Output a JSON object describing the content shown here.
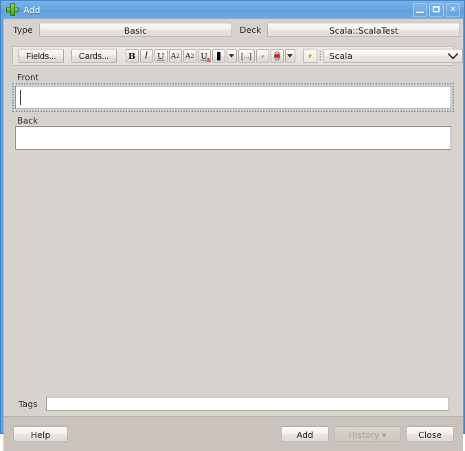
{
  "window": {
    "title": "Add",
    "icon": "green-plus-icon",
    "controls": {
      "minimize": "minimize-button",
      "maximize": "maximize-button",
      "close": "close-button",
      "close_glyph": "✕"
    },
    "title_bar_color": "#6aa6e1",
    "border_color": "#3c7ebf"
  },
  "top": {
    "type_label": "Type",
    "type_value": "Basic",
    "deck_label": "Deck",
    "deck_value": "Scala::ScalaTest"
  },
  "toolbar": {
    "fields_label": "Fields...",
    "cards_label": "Cards...",
    "bold_label": "B",
    "italic_label": "I",
    "underline_label": "U",
    "superscript_label": "A",
    "superscript_sup": "2",
    "subscript_label": "A",
    "subscript_sub": "2",
    "clear_format_label": "U",
    "clear_format_mark": "x",
    "text_color_value": "#000000",
    "color_dropdown_glyph": "▼",
    "cloze_label": "[...]",
    "attach_icon": "paperclip-icon",
    "record_icon": "record-icon",
    "record_color": "#d4252a",
    "more_dropdown_glyph": "▼",
    "bolt_icon": "lightning-bolt-icon",
    "bolt_color": "#f2c310",
    "language_value": "Scala"
  },
  "fields": [
    {
      "label": "Front",
      "value": "",
      "focused": true
    },
    {
      "label": "Back",
      "value": "",
      "focused": false
    }
  ],
  "tags": {
    "label": "Tags",
    "value": "",
    "placeholder": ""
  },
  "buttons": {
    "help": "Help",
    "add": "Add",
    "history": "History ▾",
    "history_enabled": false,
    "close": "Close"
  }
}
